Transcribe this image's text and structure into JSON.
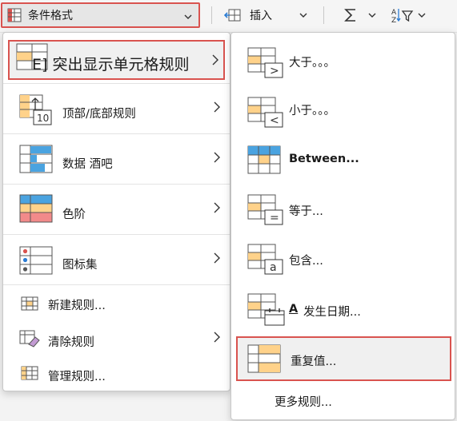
{
  "ribbon": {
    "conditional_formatting": "条件格式",
    "insert": "插入"
  },
  "menu": {
    "highlight_rules": "E] 突出显示单元格规则",
    "top_bottom": "顶部/底部规则",
    "data_bars": "数据  酒吧",
    "color_scales": "色阶",
    "icon_sets": "图标集",
    "new_rule": "新建规则...",
    "clear_rules": "清除规则",
    "manage_rules": "管理规则..."
  },
  "submenu": {
    "greater_than": "大于。。。",
    "less_than": "小于。。。",
    "between": "Between...",
    "equal_to": "等于...",
    "text_contains": "包含...",
    "date_prefix": "A",
    "date_occurring": "发生日期...",
    "duplicate_values": "重复值...",
    "more_rules": "更多规则...",
    "icon_glyphs": {
      "ten": "10",
      "gt": ">",
      "lt": "<",
      "eq": "=",
      "a": "a"
    }
  },
  "colors": {
    "accent_red": "#d9534f",
    "cell_orange": "#ffd28a",
    "cell_blue": "#4aa3e0",
    "cell_red": "#f28a8a"
  }
}
